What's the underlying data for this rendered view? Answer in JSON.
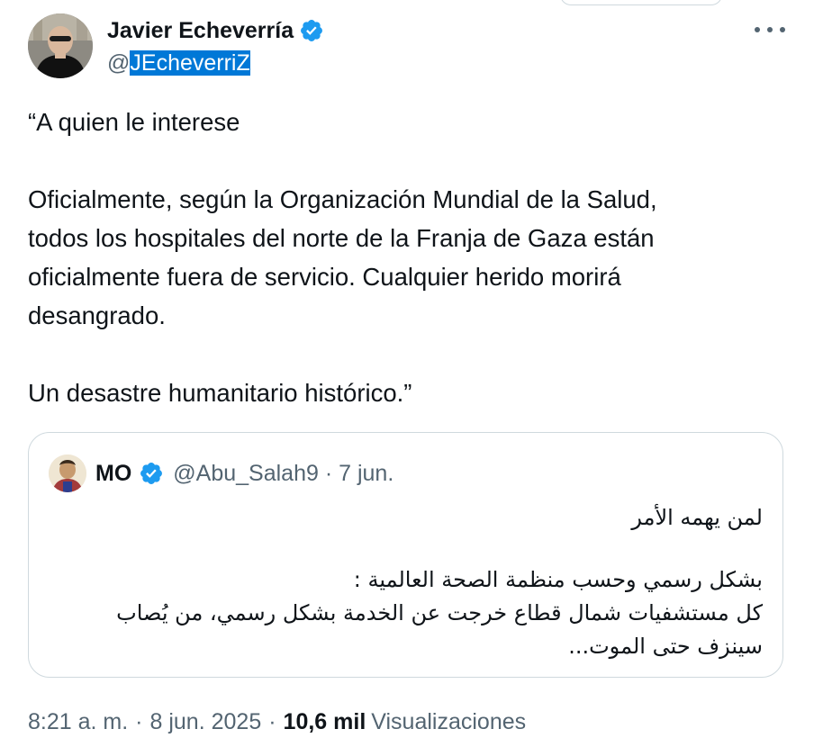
{
  "author": {
    "display_name": "Javier Echeverría",
    "handle": "@JEcheverriZ",
    "handle_at": "@",
    "handle_name": "JEcheverriZ"
  },
  "tweet": {
    "lines_1": [
      "“A quien le interese"
    ],
    "lines_2": [
      "Oficialmente, según la Organización Mundial de la Salud,",
      "todos los hospitales del norte de la Franja de Gaza están",
      "oficialmente fuera de servicio. Cualquier herido morirá",
      "desangrado."
    ],
    "lines_3": [
      "Un desastre humanitario histórico.”"
    ]
  },
  "quote": {
    "display_name": "MO",
    "handle": "@Abu_Salah9",
    "date": "7 jun.",
    "meta": "@Abu_Salah9 · 7 jun.",
    "lines_1": [
      "لمن يهمه الأمر"
    ],
    "lines_2": [
      "بشكل رسمي وحسب منظمة الصحة العالمية :",
      "كل مستشفيات شمال قطاع خرجت عن الخدمة بشكل رسمي، من يُصاب",
      "سينزف حتى الموت..."
    ]
  },
  "footer": {
    "time": "8:21 a. m.",
    "date": "8 jun. 2025",
    "views_count": "10,6 mil",
    "views_label": "Visualizaciones",
    "separator": "·"
  },
  "colors": {
    "verified_blue": "#1d9bf0",
    "secondary_text": "#536471",
    "primary_text": "#0f1419",
    "border": "#cfd9de",
    "selection": "#0078d7"
  },
  "icons": {
    "verified": "verified-badge-icon",
    "more": "more-options-icon"
  }
}
